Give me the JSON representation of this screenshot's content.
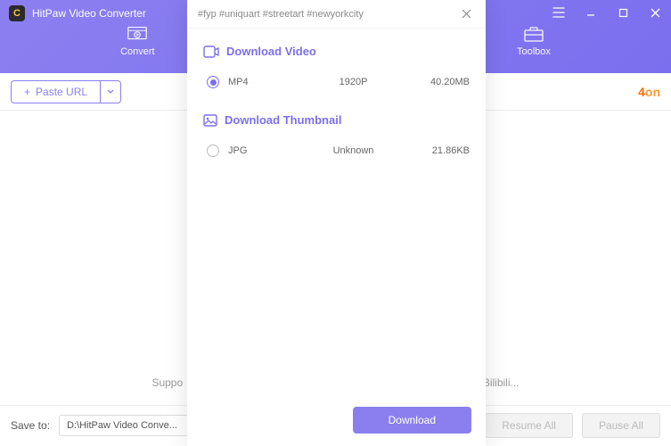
{
  "app": {
    "title": "HitPaw Video Converter"
  },
  "tabs": {
    "convert": "Convert",
    "toolbox": "Toolbox"
  },
  "toolbar": {
    "paste_url": "Paste URL",
    "badge_pre": "4",
    "badge_post": "on"
  },
  "content": {
    "support_left": "Suppo",
    "support_right": "Bilibili..."
  },
  "footer": {
    "save_to_label": "Save to:",
    "save_to_value": "D:\\HitPaw Video Conve...",
    "resume_all": "Resume All",
    "pause_all": "Pause All"
  },
  "modal": {
    "title": "#fyp #uniquart #streetart #newyorkcity",
    "section_video": "Download Video",
    "section_thumb": "Download Thumbnail",
    "video": {
      "format": "MP4",
      "resolution": "1920P",
      "size": "40.20MB"
    },
    "thumb": {
      "format": "JPG",
      "resolution": "Unknown",
      "size": "21.86KB"
    },
    "download": "Download"
  }
}
